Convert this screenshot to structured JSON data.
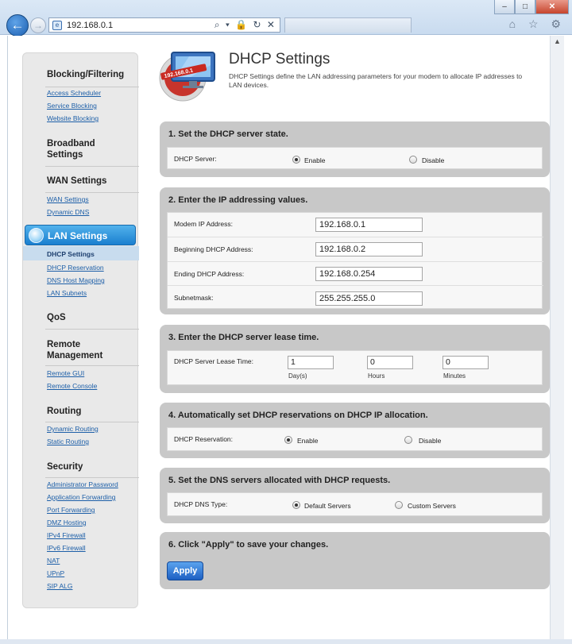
{
  "browser": {
    "address": "192.168.0.1",
    "address_tools": "⌕ ▾ 🔒 ↻ ✕",
    "right_icons": "⌂ ☆ ⚙",
    "window_buttons": [
      "–",
      "□",
      "✕"
    ]
  },
  "header": {
    "logo_text": "192.168.0.1",
    "title": "DHCP Settings",
    "description": "DHCP Settings define the LAN addressing parameters for your modem to allocate IP addresses to LAN devices."
  },
  "sidebar": {
    "blocking": {
      "heading": "Blocking/Filtering",
      "links": [
        "Access Scheduler",
        "Service Blocking",
        "Website Blocking"
      ]
    },
    "broadband": {
      "heading_1": "Broadband",
      "heading_2": "Settings"
    },
    "wan": {
      "heading": "WAN Settings",
      "links": [
        "WAN Settings",
        "Dynamic DNS"
      ]
    },
    "lan": {
      "heading": "LAN Settings",
      "links": [
        "DHCP Settings",
        "DHCP Reservation",
        "DNS Host Mapping",
        "LAN Subnets"
      ]
    },
    "qos": {
      "heading": "QoS"
    },
    "remote": {
      "heading_1": "Remote",
      "heading_2": "Management",
      "links": [
        "Remote GUI",
        "Remote Console"
      ]
    },
    "routing": {
      "heading": "Routing",
      "links": [
        "Dynamic Routing",
        "Static Routing"
      ]
    },
    "security": {
      "heading": "Security",
      "links": [
        "Administrator Password",
        "Application Forwarding",
        "Port Forwarding",
        "DMZ Hosting",
        "IPv4 Firewall",
        "IPv6 Firewall",
        "NAT",
        "UPnP",
        "SIP ALG"
      ]
    }
  },
  "sections": {
    "server_state": {
      "title": "1. Set the DHCP server state.",
      "label": "DHCP Server:",
      "enable": "Enable",
      "disable": "Disable",
      "selected": "Enable"
    },
    "ip_values": {
      "title": "2. Enter the IP addressing values.",
      "modem_ip_label": "Modem IP Address:",
      "modem_ip": "192.168.0.1",
      "begin_label": "Beginning DHCP Address:",
      "begin": "192.168.0.2",
      "end_label": "Ending DHCP Address:",
      "end": "192.168.0.254",
      "mask_label": "Subnetmask:",
      "mask": "255.255.255.0"
    },
    "lease": {
      "title": "3. Enter the DHCP server lease time.",
      "label": "DHCP Server Lease Time:",
      "days": "1",
      "days_label": "Day(s)",
      "hours": "0",
      "hours_label": "Hours",
      "minutes": "0",
      "minutes_label": "Minutes"
    },
    "reservation": {
      "title": "4. Automatically set DHCP reservations on DHCP IP allocation.",
      "label": "DHCP Reservation:",
      "enable": "Enable",
      "disable": "Disable",
      "selected": "Enable"
    },
    "dns": {
      "title": "5. Set the DNS servers allocated with DHCP requests.",
      "label": "DHCP DNS Type:",
      "default": "Default Servers",
      "custom": "Custom Servers",
      "selected": "Default Servers"
    },
    "apply": {
      "title": "6. Click \"Apply\" to save your changes.",
      "button": "Apply"
    }
  }
}
